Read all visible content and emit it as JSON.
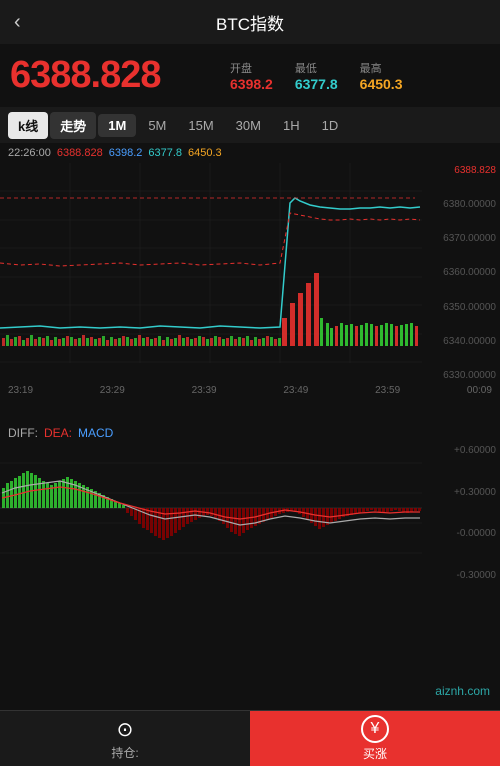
{
  "header": {
    "title": "BTC指数",
    "back_label": "‹"
  },
  "price": {
    "main": "6388.828",
    "open_label": "开盘",
    "open_value": "6398.2",
    "low_label": "最低",
    "low_value": "6377.8",
    "high_label": "最高",
    "high_value": "6450.3"
  },
  "tabs": {
    "items": [
      "k线",
      "走势",
      "1M",
      "5M",
      "15M",
      "30M",
      "1H",
      "1D"
    ],
    "active_index": 0,
    "trend_index": 1,
    "timeframe_active": 2
  },
  "info_bar": {
    "time": "22:26:00",
    "v1": "6388.828",
    "v2": "6398.2",
    "v3": "6377.8",
    "v4": "6450.3"
  },
  "y_axis": {
    "values": [
      "6388.828",
      "6380.00000",
      "6370.00000",
      "6360.00000",
      "6350.00000",
      "6340.00000",
      "6330.00000"
    ]
  },
  "x_axis": {
    "labels": [
      "23:19",
      "23:29",
      "23:39",
      "23:49",
      "23:59",
      "00:09"
    ]
  },
  "macd": {
    "diff_label": "DIFF:",
    "dea_label": "DEA:",
    "macd_label": "MACD"
  },
  "macd_y_axis": {
    "values": [
      "+0.60000",
      "+0.30000",
      "-0.00000",
      "-0.30000"
    ]
  },
  "bottom_nav": {
    "hold_icon": "⊙",
    "hold_label": "持仓:",
    "buy_icon": "¥",
    "buy_label": "买涨"
  },
  "watermark": "aiznh.com"
}
